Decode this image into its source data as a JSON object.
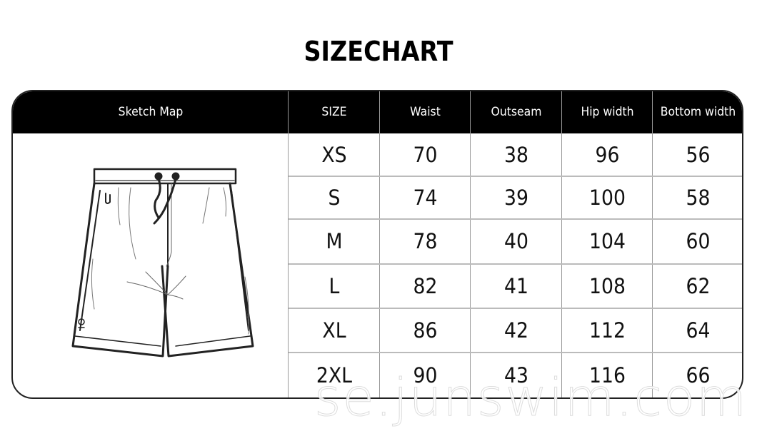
{
  "title": "SIZECHART",
  "table": {
    "headers": [
      "Sketch Map",
      "SIZE",
      "Waist",
      "Outseam",
      "Hip width",
      "Bottom width"
    ],
    "rows": [
      {
        "size": "XS",
        "waist": "70",
        "outseam": "38",
        "hip": "96",
        "bottom": "56"
      },
      {
        "size": "S",
        "waist": "74",
        "outseam": "39",
        "hip": "100",
        "bottom": "58"
      },
      {
        "size": "M",
        "waist": "78",
        "outseam": "40",
        "hip": "104",
        "bottom": "60"
      },
      {
        "size": "L",
        "waist": "82",
        "outseam": "41",
        "hip": "108",
        "bottom": "62"
      },
      {
        "size": "XL",
        "waist": "86",
        "outseam": "42",
        "hip": "112",
        "bottom": "64"
      },
      {
        "size": "2XL",
        "waist": "90",
        "outseam": "43",
        "hip": "116",
        "bottom": "66"
      }
    ]
  },
  "sketch": {
    "icon": "shorts-sketch-icon",
    "description": "Line drawing of board shorts with drawstring"
  },
  "watermark": "se.junswim.com"
}
